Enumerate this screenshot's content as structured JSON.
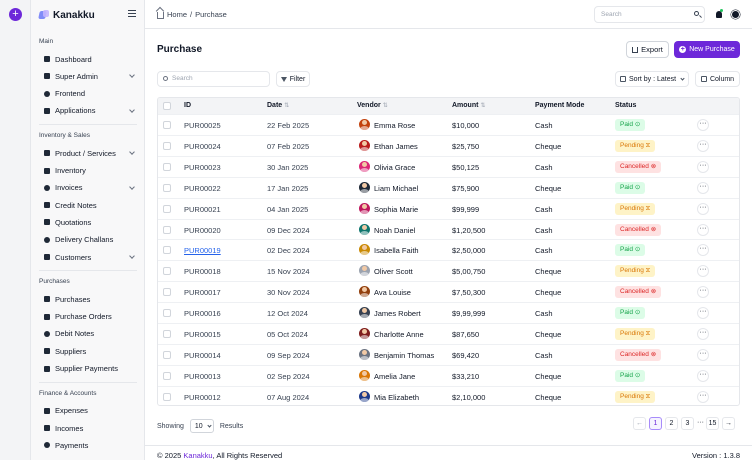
{
  "app": {
    "brand": "Kanakku"
  },
  "sidebar": {
    "sections": [
      {
        "title": "Main",
        "items": [
          {
            "label": "Dashboard",
            "icon": "dashboard-icon",
            "chevron": false
          },
          {
            "label": "Super Admin",
            "icon": "user-shield-icon",
            "chevron": true
          },
          {
            "label": "Frontend",
            "icon": "globe-icon",
            "chevron": false
          },
          {
            "label": "Applications",
            "icon": "apps-icon",
            "chevron": true
          }
        ]
      },
      {
        "title": "Inventory & Sales",
        "items": [
          {
            "label": "Product / Services",
            "icon": "box-icon",
            "chevron": true
          },
          {
            "label": "Inventory",
            "icon": "inventory-icon",
            "chevron": false
          },
          {
            "label": "Invoices",
            "icon": "invoice-icon",
            "chevron": true
          },
          {
            "label": "Credit Notes",
            "icon": "credit-note-icon",
            "chevron": false
          },
          {
            "label": "Quotations",
            "icon": "quotation-icon",
            "chevron": false
          },
          {
            "label": "Delivery Challans",
            "icon": "truck-icon",
            "chevron": false
          },
          {
            "label": "Customers",
            "icon": "users-icon",
            "chevron": true
          }
        ]
      },
      {
        "title": "Purchases",
        "items": [
          {
            "label": "Purchases",
            "icon": "purchase-icon",
            "chevron": false
          },
          {
            "label": "Purchase Orders",
            "icon": "order-icon",
            "chevron": false
          },
          {
            "label": "Debit Notes",
            "icon": "debit-note-icon",
            "chevron": false
          },
          {
            "label": "Suppliers",
            "icon": "supplier-icon",
            "chevron": false
          },
          {
            "label": "Supplier Payments",
            "icon": "payment-icon",
            "chevron": false
          }
        ]
      },
      {
        "title": "Finance & Accounts",
        "items": [
          {
            "label": "Expenses",
            "icon": "expense-icon",
            "chevron": false
          },
          {
            "label": "Incomes",
            "icon": "income-icon",
            "chevron": false
          },
          {
            "label": "Payments",
            "icon": "payments-icon",
            "chevron": false
          }
        ]
      }
    ]
  },
  "topbar": {
    "breadcrumb_home": "Home",
    "breadcrumb_sep": "/",
    "breadcrumb_current": "Purchase",
    "search_placeholder": "Search"
  },
  "page": {
    "title": "Purchase",
    "export_label": "Export",
    "new_label": "New Purchase",
    "search_placeholder": "Search",
    "filter_label": "Filter",
    "sort_label": "Sort by : Latest",
    "column_label": "Column"
  },
  "table": {
    "headers": {
      "id": "ID",
      "date": "Date",
      "vendor": "Vendor",
      "amount": "Amount",
      "mode": "Payment Mode",
      "status": "Status"
    },
    "rows": [
      {
        "id": "PUR00025",
        "date": "22 Feb 2025",
        "vendor": "Emma Rose",
        "amount": "$10,000",
        "mode": "Cash",
        "status": "Paid",
        "kind": "paid",
        "avatar": "#c2410c"
      },
      {
        "id": "PUR00024",
        "date": "07 Feb 2025",
        "vendor": "Ethan James",
        "amount": "$25,750",
        "mode": "Cheque",
        "status": "Pending",
        "kind": "pending",
        "avatar": "#b91c1c"
      },
      {
        "id": "PUR00023",
        "date": "30 Jan 2025",
        "vendor": "Olivia Grace",
        "amount": "$50,125",
        "mode": "Cash",
        "status": "Cancelled",
        "kind": "cancelled",
        "avatar": "#db2777"
      },
      {
        "id": "PUR00022",
        "date": "17 Jan 2025",
        "vendor": "Liam Michael",
        "amount": "$75,900",
        "mode": "Cheque",
        "status": "Paid",
        "kind": "paid",
        "avatar": "#1f2937"
      },
      {
        "id": "PUR00021",
        "date": "04 Jan 2025",
        "vendor": "Sophia Marie",
        "amount": "$99,999",
        "mode": "Cash",
        "status": "Pending",
        "kind": "pending",
        "avatar": "#be185d"
      },
      {
        "id": "PUR00020",
        "date": "09 Dec 2024",
        "vendor": "Noah Daniel",
        "amount": "$1,20,500",
        "mode": "Cash",
        "status": "Cancelled",
        "kind": "cancelled",
        "avatar": "#0f766e"
      },
      {
        "id": "PUR00019",
        "date": "02 Dec 2024",
        "vendor": "Isabella Faith",
        "amount": "$2,50,000",
        "mode": "Cash",
        "status": "Paid",
        "kind": "paid",
        "avatar": "#ca8a04",
        "link": true
      },
      {
        "id": "PUR00018",
        "date": "15 Nov 2024",
        "vendor": "Oliver Scott",
        "amount": "$5,00,750",
        "mode": "Cheque",
        "status": "Pending",
        "kind": "pending",
        "avatar": "#9ca3af"
      },
      {
        "id": "PUR00017",
        "date": "30 Nov 2024",
        "vendor": "Ava Louise",
        "amount": "$7,50,300",
        "mode": "Cheque",
        "status": "Cancelled",
        "kind": "cancelled",
        "avatar": "#92400e"
      },
      {
        "id": "PUR00016",
        "date": "12 Oct 2024",
        "vendor": "James Robert",
        "amount": "$9,99,999",
        "mode": "Cash",
        "status": "Paid",
        "kind": "paid",
        "avatar": "#374151"
      },
      {
        "id": "PUR00015",
        "date": "05 Oct 2024",
        "vendor": "Charlotte Anne",
        "amount": "$87,650",
        "mode": "Cheque",
        "status": "Pending",
        "kind": "pending",
        "avatar": "#7f1d1d"
      },
      {
        "id": "PUR00014",
        "date": "09 Sep 2024",
        "vendor": "Benjamin Thomas",
        "amount": "$69,420",
        "mode": "Cash",
        "status": "Cancelled",
        "kind": "cancelled",
        "avatar": "#6b7280"
      },
      {
        "id": "PUR00013",
        "date": "02 Sep 2024",
        "vendor": "Amelia Jane",
        "amount": "$33,210",
        "mode": "Cheque",
        "status": "Paid",
        "kind": "paid",
        "avatar": "#d97706"
      },
      {
        "id": "PUR00012",
        "date": "07 Aug 2024",
        "vendor": "Mia Elizabeth",
        "amount": "$2,10,000",
        "mode": "Cheque",
        "status": "Pending",
        "kind": "pending",
        "avatar": "#1e3a8a"
      }
    ]
  },
  "pagination": {
    "showing_label": "Showing",
    "page_size": "10",
    "results_label": "Results",
    "prev": "←",
    "pages": [
      "1",
      "2",
      "3"
    ],
    "dots": "···",
    "last": "15",
    "next": "→"
  },
  "footer": {
    "copyright_prefix": "© 2025 ",
    "brand": "Kanakku",
    "copyright_suffix": ", All Rights Reserved",
    "version": "Version : 1.3.8"
  },
  "colors": {
    "accent": "#6d28d9",
    "paid": "#16a34a",
    "pending": "#d97706",
    "cancelled": "#dc2626"
  }
}
